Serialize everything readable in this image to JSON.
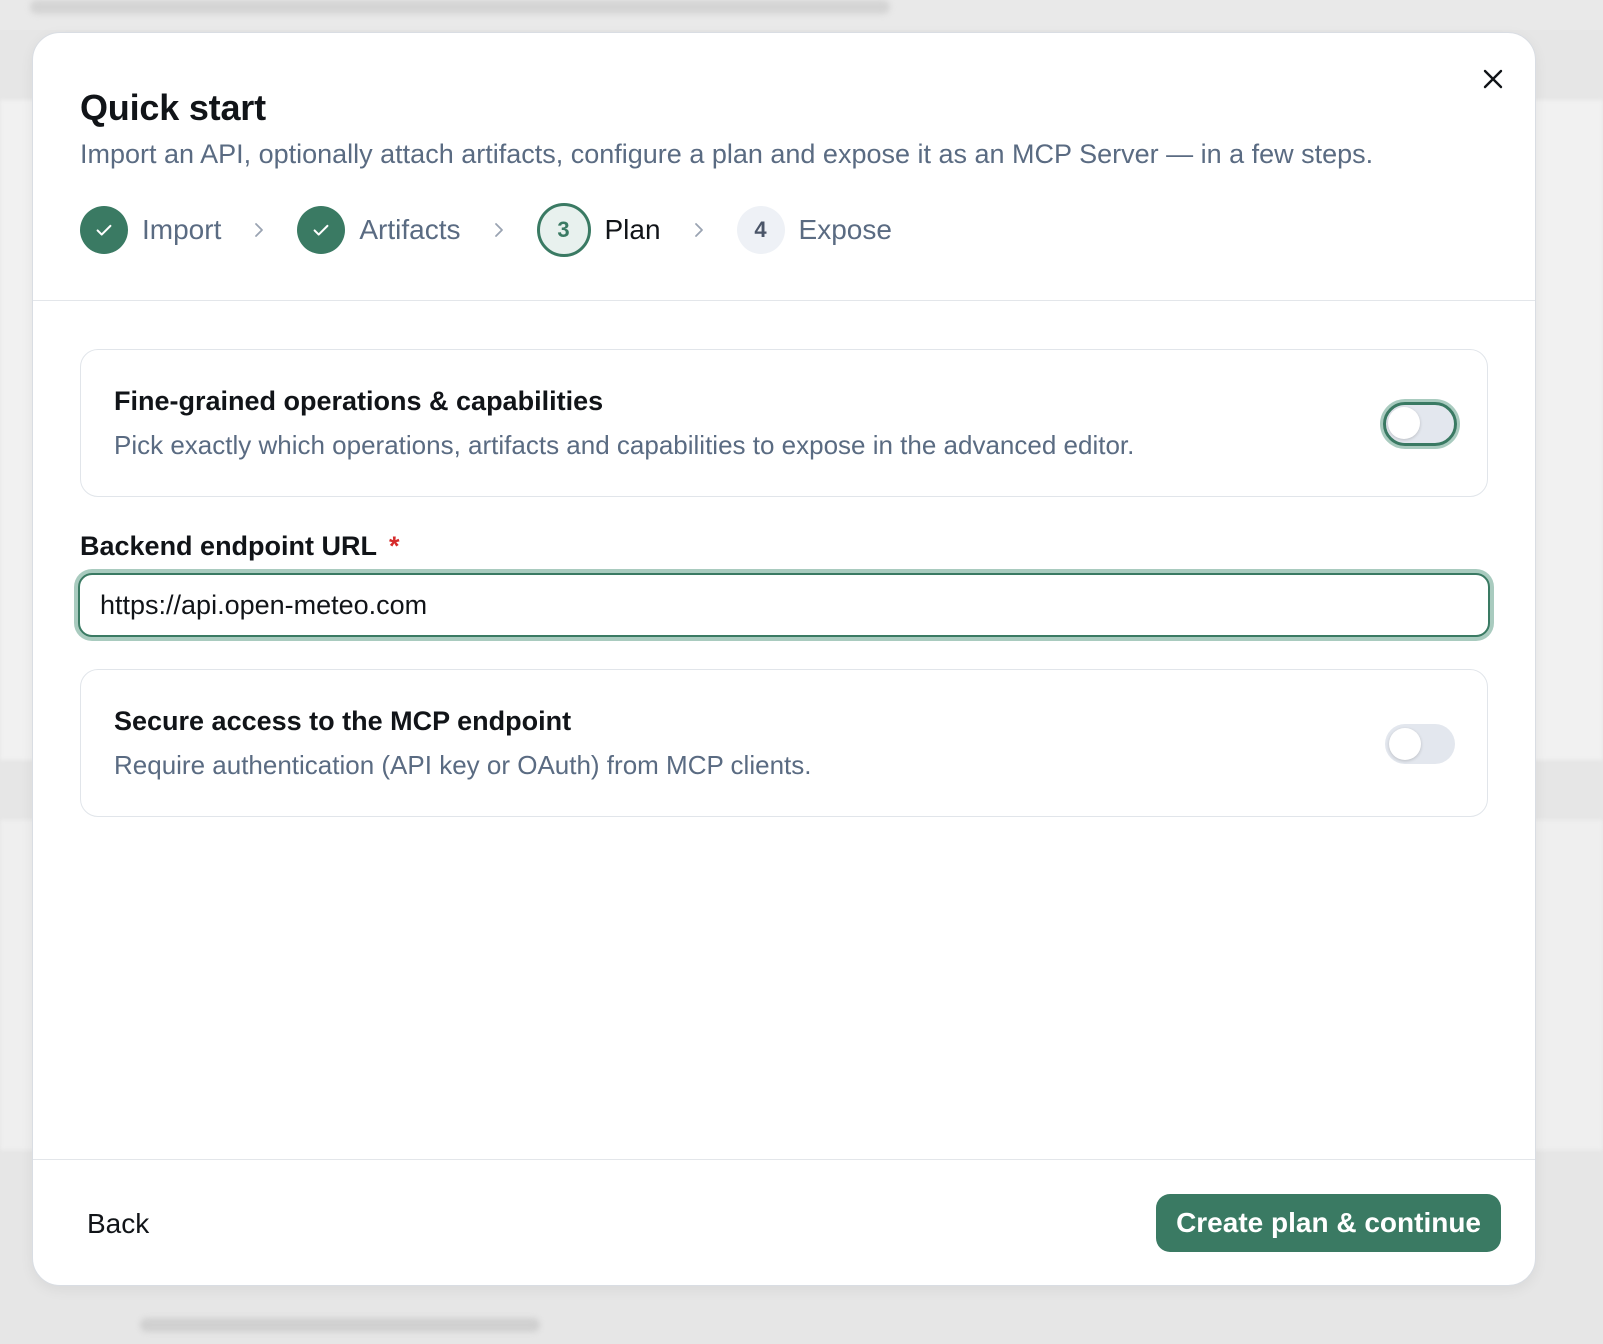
{
  "dialog": {
    "title": "Quick start",
    "subtitle": "Import an API, optionally attach artifacts, configure a plan and expose it as an MCP Server — in a few steps.",
    "close_icon": "close-icon"
  },
  "stepper": {
    "steps": [
      {
        "label": "Import",
        "state": "done",
        "icon": "check-icon"
      },
      {
        "label": "Artifacts",
        "state": "done",
        "icon": "check-icon"
      },
      {
        "label": "Plan",
        "state": "current",
        "number": "3"
      },
      {
        "label": "Expose",
        "state": "upcoming",
        "number": "4"
      }
    ],
    "separator_icon": "chevron-right-icon"
  },
  "options": {
    "fine_grained": {
      "title": "Fine-grained operations & capabilities",
      "description": "Pick exactly which operations, artifacts and capabilities to expose in the advanced editor.",
      "enabled": false
    },
    "secure_access": {
      "title": "Secure access to the MCP endpoint",
      "description": "Require authentication (API key or OAuth) from MCP clients.",
      "enabled": false
    }
  },
  "backend_url": {
    "label": "Backend endpoint URL",
    "required_mark": "*",
    "value": "https://api.open-meteo.com"
  },
  "footer": {
    "back_label": "Back",
    "primary_label": "Create plan & continue"
  },
  "colors": {
    "accent": "#3a7a63",
    "required": "#d62b2b",
    "muted_text": "#5a6b82"
  }
}
